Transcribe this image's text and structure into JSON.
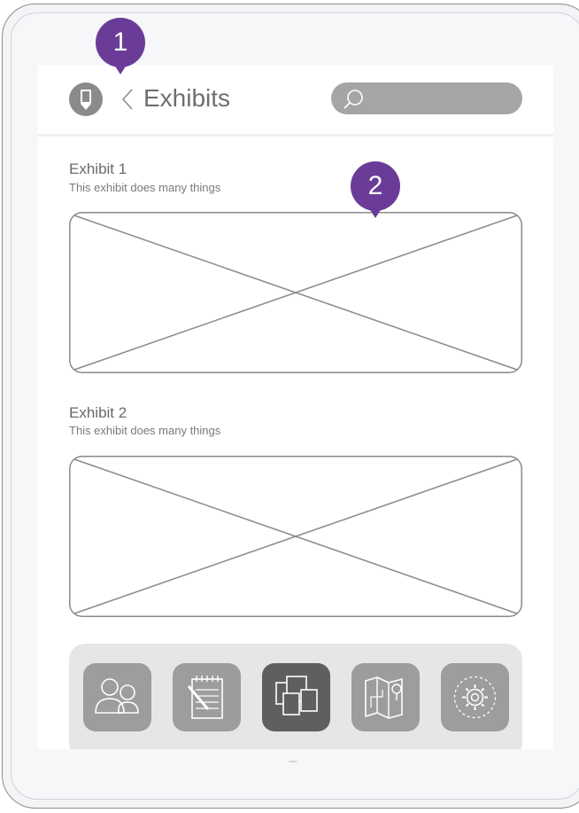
{
  "header": {
    "title": "Exhibits",
    "search_placeholder": ""
  },
  "callouts": [
    "1",
    "2"
  ],
  "exhibits": [
    {
      "title": "Exhibit 1",
      "description": "This exhibit does many things"
    },
    {
      "title": "Exhibit 2",
      "description": "This exhibit does many things"
    }
  ],
  "dock": {
    "items": [
      {
        "icon": "people-icon",
        "active": false
      },
      {
        "icon": "notepad-icon",
        "active": false
      },
      {
        "icon": "gallery-icon",
        "active": true
      },
      {
        "icon": "map-icon",
        "active": false
      },
      {
        "icon": "settings-icon",
        "active": false
      }
    ]
  },
  "colors": {
    "callout": "#6b3c97",
    "dock_active": "#5f5f5f",
    "dock_inactive": "#9d9d9d"
  }
}
